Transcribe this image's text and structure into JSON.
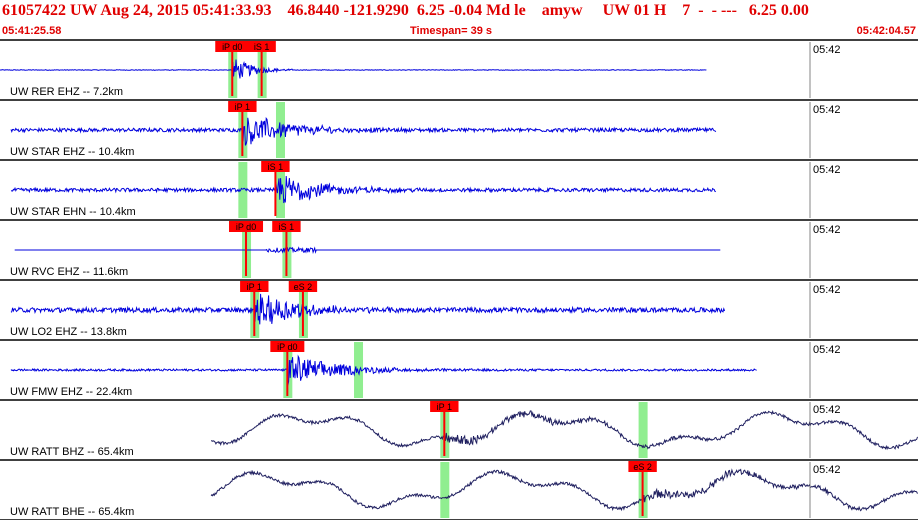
{
  "header": {
    "title": "61057422 UW Aug 24, 2015 05:41:33.93    46.8440 -121.9290  6.25 -0.04 Md le    amyw     UW 01 H    7  -  - ---   6.25 0.00",
    "start_time": "05:41:25.58",
    "timespan": "Timespan=  39 s",
    "end_time": "05:42:04.57"
  },
  "time_marker": "05:42",
  "colors": {
    "header_text": "#e00000",
    "trace": "#0000dd",
    "trace_lp": "#202060",
    "pick": "#ff0000",
    "window": "#90ee90"
  },
  "traces": [
    {
      "label": "UW RER EHZ -- 7.2km",
      "color": "#0000dd",
      "amp": 0.6,
      "noise": 0.01,
      "start": 0.0,
      "end": 0.77,
      "type": "rer",
      "picks": [
        {
          "label": "iP d0",
          "x": 0.253
        },
        {
          "label": "iS 1",
          "x": 0.285
        }
      ],
      "windows": [
        0.253,
        0.285
      ]
    },
    {
      "label": "UW STAR EHZ -- 10.4km",
      "color": "#0000dd",
      "amp": 0.5,
      "noise": 0.12,
      "start": 0.012,
      "end": 0.78,
      "type": "quake",
      "picks": [
        {
          "label": "iP 1",
          "x": 0.264
        }
      ],
      "windows": [
        0.264,
        0.305
      ]
    },
    {
      "label": "UW STAR EHN -- 10.4km",
      "color": "#0000dd",
      "amp": 0.45,
      "noise": 0.12,
      "start": 0.012,
      "end": 0.78,
      "type": "quake",
      "picks": [
        {
          "label": "iS 1",
          "x": 0.3
        }
      ],
      "windows": [
        0.264,
        0.305
      ]
    },
    {
      "label": "UW RVC EHZ -- 11.6km",
      "color": "#0000dd",
      "amp": 0.5,
      "noise": 0.0,
      "start": 0.016,
      "end": 0.785,
      "type": "rvc",
      "picks": [
        {
          "label": "iP d0",
          "x": 0.268
        },
        {
          "label": "iS 1",
          "x": 0.312
        }
      ],
      "windows": [
        0.268,
        0.312
      ]
    },
    {
      "label": "UW LO2 EHZ -- 13.8km",
      "color": "#0000dd",
      "amp": 0.5,
      "noise": 0.16,
      "start": 0.012,
      "end": 0.79,
      "type": "quake",
      "picks": [
        {
          "label": "iP 1",
          "x": 0.277
        },
        {
          "label": "eS 2",
          "x": 0.33
        }
      ],
      "windows": [
        0.277,
        0.33
      ]
    },
    {
      "label": "UW FMW EHZ -- 22.4km",
      "color": "#0000dd",
      "amp": 0.5,
      "noise": 0.07,
      "start": 0.012,
      "end": 0.825,
      "type": "quake",
      "picks": [
        {
          "label": "iP d0",
          "x": 0.313
        }
      ],
      "windows": [
        0.313,
        0.39
      ]
    },
    {
      "label": "UW RATT BHZ -- 65.4km",
      "color": "#202060",
      "amp": 0.5,
      "noise": 0.05,
      "start": 0.23,
      "end": 1.0,
      "type": "lp",
      "picks": [
        {
          "label": "iP 1",
          "x": 0.484
        }
      ],
      "windows": [
        0.484,
        0.7
      ]
    },
    {
      "label": "UW RATT BHE -- 65.4km",
      "color": "#202060",
      "amp": 0.5,
      "noise": 0.05,
      "start": 0.23,
      "end": 1.0,
      "type": "lp",
      "picks": [
        {
          "label": "eS 2",
          "x": 0.7
        }
      ],
      "windows": [
        0.484,
        0.7
      ]
    }
  ]
}
